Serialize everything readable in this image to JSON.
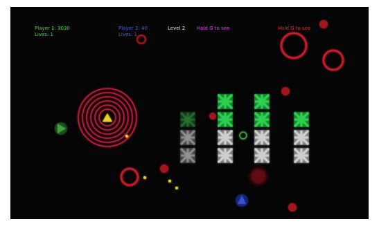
{
  "hud": {
    "player1": {
      "score_text": "Player 1: 3030",
      "lives_text": "Lives: 1",
      "color": "#4fd84f"
    },
    "player2": {
      "score_text": "Player 2: 40",
      "lives_text": "Lives: 1",
      "color": "#4a63d8"
    },
    "level_text": "Level 2",
    "hint_center": {
      "text": "Hold G to see",
      "color": "#d84fd8"
    },
    "hint_right": {
      "text": "Hold G to see",
      "color": "#e03030"
    }
  },
  "colors": {
    "background": "#050505",
    "spiral": "#c01a3a",
    "enemy_ring": "#c01a2a",
    "alien_green": "#2fd04f",
    "alien_white": "#cfcfcf",
    "player1_ship": "#3fa03f",
    "player2_ship": "#3a4fd0",
    "bullet": "#e8d020"
  },
  "sprites": {
    "player1_ship": "green-triangle-ship-icon",
    "player2_ship": "blue-triangle-ship-icon",
    "alien": "x-pattern-alien-icon"
  }
}
